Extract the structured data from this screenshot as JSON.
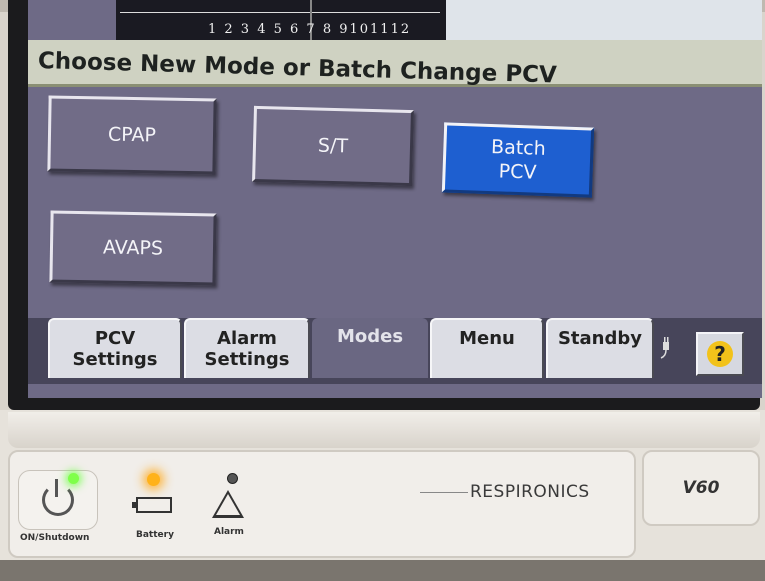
{
  "screen": {
    "axis_ticks": "1 2 3 4 5 6 7 8 9101112",
    "title": "Choose New Mode or Batch Change PCV"
  },
  "modes": {
    "cpap": "CPAP",
    "st": "S/T",
    "batch_pcv": "Batch\nPCV",
    "avaps": "AVAPS"
  },
  "tabs": {
    "pcv_settings": "PCV\nSettings",
    "alarm_settings": "Alarm\nSettings",
    "modes": "Modes",
    "menu": "Menu",
    "standby": "Standby",
    "help": "?"
  },
  "device": {
    "power_label": "ON/Shutdown",
    "battery_label": "Battery",
    "alarm_label": "Alarm",
    "brand": "RESPIRONICS",
    "model": "V60"
  },
  "colors": {
    "selected_mode": "#1e5fd0",
    "screen_background": "#6e6a86",
    "power_led": "#7fff4a",
    "battery_led": "#ffb21a"
  },
  "icons": {
    "plug": "plug-icon",
    "help": "question-icon",
    "power": "power-icon",
    "battery": "battery-icon",
    "alarm": "alarm-bell-icon"
  }
}
